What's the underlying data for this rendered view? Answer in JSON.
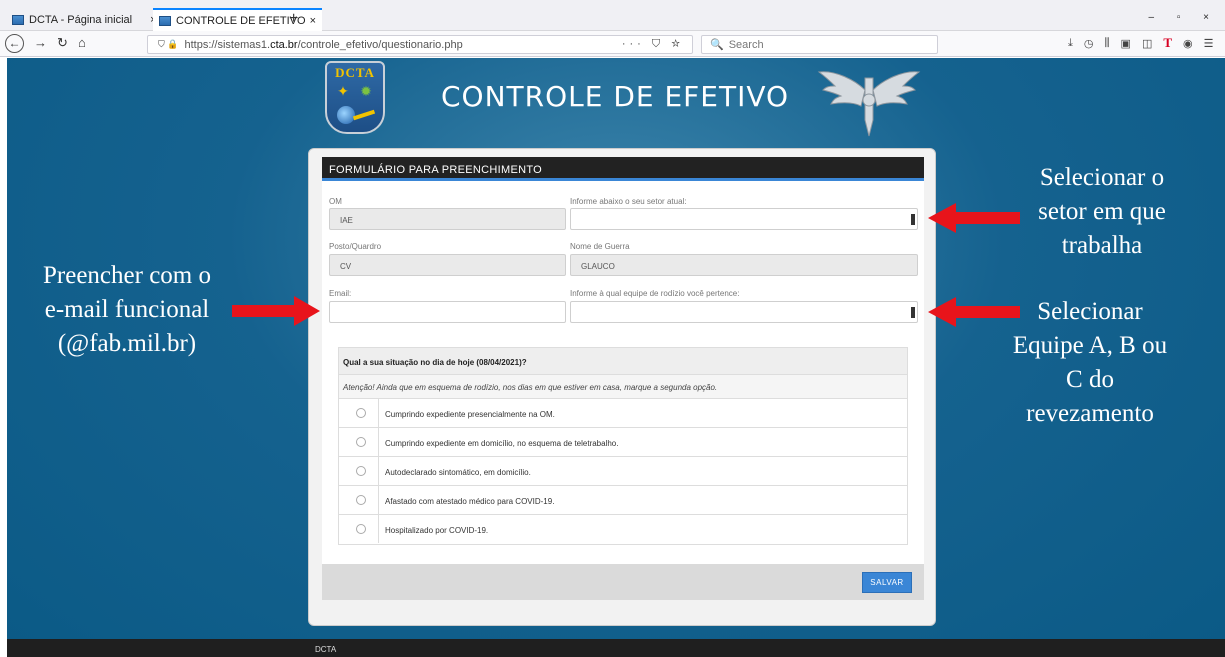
{
  "browser": {
    "tabs": [
      {
        "label": "DCTA - Página inicial",
        "close": "×"
      },
      {
        "label": "CONTROLE DE EFETIVO",
        "close": "×"
      }
    ],
    "new_tab": "+",
    "url_prefix": "https://sistemas1.",
    "url_host": "cta.br",
    "url_path": "/controle_efetivo/questionario.php",
    "url_actions": "··· ⛉ ☆",
    "search_placeholder": "Search"
  },
  "header": {
    "logo_text": "DCTA",
    "title": "CONTROLE DE EFETIVO"
  },
  "form": {
    "heading": "FORMULÁRIO PARA PREENCHIMENTO",
    "om_label": "OM",
    "om_value": "IAE",
    "setor_label": "Informe abaixo o seu setor atual:",
    "setor_value": "",
    "posto_label": "Posto/Quardro",
    "posto_value": "CV",
    "nome_label": "Nome de Guerra",
    "nome_value": "GLAUCO",
    "email_label": "Email:",
    "email_value": "",
    "equipe_label": "Informe à qual equipe de rodízio você pertence:",
    "equipe_value": "",
    "question": "Qual a sua situação no dia de hoje (08/04/2021)?",
    "note": "Atenção! Ainda que em esquema de rodízio, nos dias em que estiver em casa, marque a segunda opção.",
    "options": [
      "Cumprindo expediente presencialmente na OM.",
      "Cumprindo expediente em domicílio, no esquema de teletrabalho.",
      "Autodeclarado sintomático, em domicílio.",
      "Afastado com atestado médico para COVID-19.",
      "Hospitalizado por COVID-19."
    ],
    "save_label": "SALVAR"
  },
  "annotations": {
    "email_line1": "Preencher com o",
    "email_line2": "e-mail funcional",
    "email_line3": "(@fab.mil.br)",
    "setor_line1": "Selecionar o",
    "setor_line2": "setor em que",
    "setor_line3": "trabalha",
    "equipe_line1": "Selecionar",
    "equipe_line2": "Equipe A, B ou",
    "equipe_line3": "C do",
    "equipe_line4": "revezamento"
  },
  "footer": {
    "text": "DCTA"
  },
  "colors": {
    "page_bg": "#0b5a86",
    "accent": "#3a86d6",
    "arrow": "#e8141b"
  }
}
